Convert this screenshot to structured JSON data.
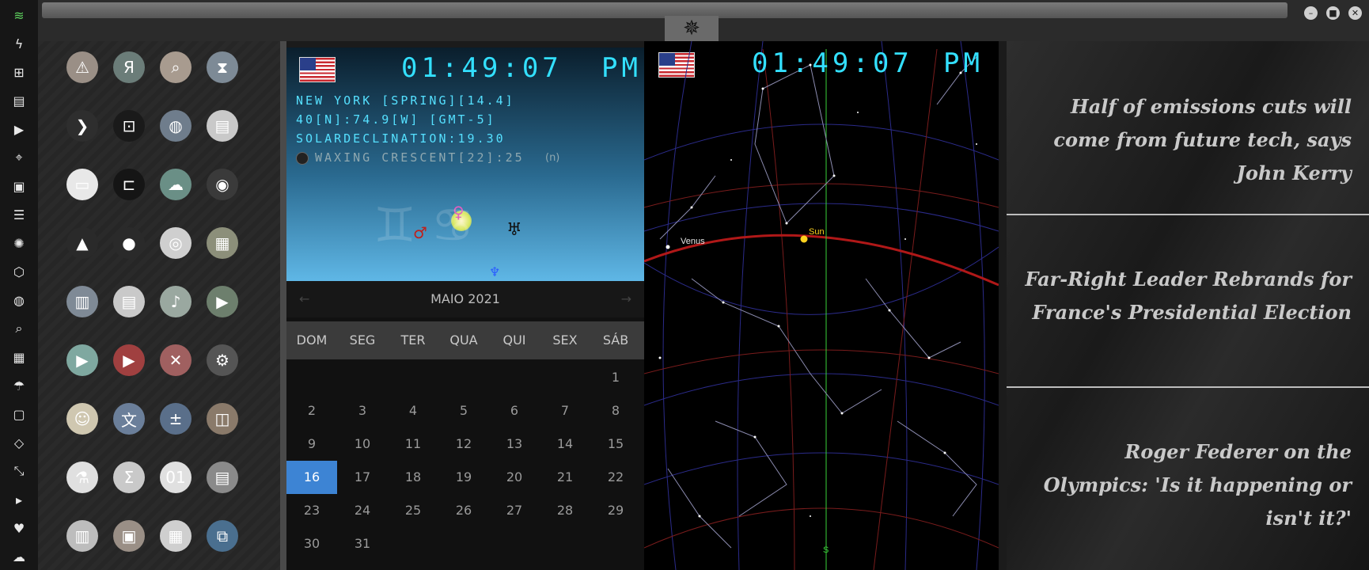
{
  "dock": {
    "icons": [
      "wifi-icon",
      "bolt-icon",
      "windows-icon",
      "archive-icon",
      "play-circle-icon",
      "maps-icon",
      "image-icon",
      "news-icon",
      "aperture-icon",
      "hexagon-icon",
      "globe-icon",
      "search-icon",
      "map-icon",
      "umbrella-icon",
      "contact-icon",
      "code-icon",
      "fullscreen-icon",
      "youtube-icon",
      "heart-icon",
      "cloud-icon"
    ]
  },
  "apps": [
    [
      "warning-icon",
      "yandex-icon",
      "magnifier-icon",
      "hourglass-icon"
    ],
    [
      "prompt-icon",
      "terminal-icon",
      "web-globe-icon",
      "printer-icon"
    ],
    [
      "window-icon",
      "bed-icon",
      "cloud-lock-icon",
      "github-icon"
    ],
    [
      "starfleet-icon",
      "death-star-icon",
      "wikipedia-icon",
      "world-map-icon"
    ],
    [
      "docs-icon",
      "notes-icon",
      "music-icon",
      "video-icon"
    ],
    [
      "play-button-icon",
      "media-play-icon",
      "close-circle-icon",
      "gears-icon"
    ],
    [
      "droid-icon",
      "translate-icon",
      "calculator-icon",
      "camera-icon"
    ],
    [
      "flask-icon",
      "sigma-icon",
      "binary-icon",
      "spreadsheet-icon"
    ],
    [
      "document-icon",
      "picture-icon",
      "presentation-icon",
      "vscode-icon"
    ]
  ],
  "clock_left": {
    "time": "01:49:07",
    "ampm": "PM",
    "line1": "NEW YORK [SPRING][14.4]",
    "line2": "40[N]:74.9[W] [GMT-5]",
    "line3": "SOLARDECLINATION:19.30",
    "line4": "WAXING CRESCENT[22]:25",
    "line4_suffix": "(n)"
  },
  "clock_right": {
    "time": "01:49:07",
    "ampm": "PM"
  },
  "calendar": {
    "month": "MAIO 2021",
    "prev": "←",
    "next": "→",
    "weekdays": [
      "DOM",
      "SEG",
      "TER",
      "QUA",
      "QUI",
      "SEX",
      "SÁB"
    ],
    "rows": [
      [
        "",
        "",
        "",
        "",
        "",
        "",
        "1"
      ],
      [
        "2",
        "3",
        "4",
        "5",
        "6",
        "7",
        "8"
      ],
      [
        "9",
        "10",
        "11",
        "12",
        "13",
        "14",
        "15"
      ],
      [
        "16",
        "17",
        "18",
        "19",
        "20",
        "21",
        "22"
      ],
      [
        "23",
        "24",
        "25",
        "26",
        "27",
        "28",
        "29"
      ],
      [
        "30",
        "31",
        "",
        "",
        "",
        "",
        ""
      ]
    ],
    "selected": "16"
  },
  "sky": {
    "venus": "Venus",
    "sun": "Sun",
    "south": "S"
  },
  "news": {
    "headlines": [
      "Half of emissions cuts will come from future tech, says John Kerry",
      "Far-Right Leader Rebrands for France's Presidential Election",
      "Roger Federer on the Olympics: 'Is it happening or isn't it?'"
    ]
  },
  "colors": {
    "accent": "#3d84d4",
    "clock": "#33e0ff",
    "ecliptic": "#c0392b"
  }
}
